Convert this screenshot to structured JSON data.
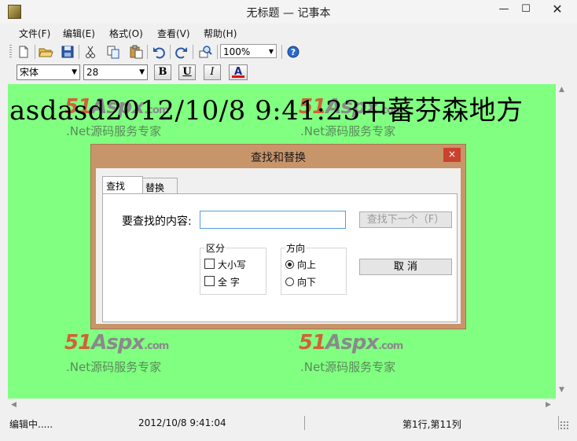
{
  "window": {
    "title": "无标题 — 记事本",
    "min": "—",
    "max": "☐",
    "close": "✕"
  },
  "menu": [
    "文件(F)",
    "编辑(E)",
    "格式(O)",
    "查看(V)",
    "帮助(H)"
  ],
  "toolbar": {
    "icons": [
      "new-file-icon",
      "open-folder-icon",
      "save-icon",
      "cut-icon",
      "copy-icon",
      "paste-icon",
      "undo-icon",
      "redo-icon",
      "find-icon",
      "help-icon"
    ],
    "zoom": "100%"
  },
  "format": {
    "font": "宋体",
    "size": "28",
    "bold": "B",
    "underline": "U",
    "italic": "I",
    "color": "A"
  },
  "editor": {
    "text": "asdasd2012/10/8 9:41:23中蕃芬森地方",
    "background": "#80ff80"
  },
  "watermark": {
    "logo_num": "51",
    "logo_word": "Aspx",
    "logo_tld": ".com",
    "subtitle": ".Net源码服务专家"
  },
  "statusbar": {
    "state": "编辑中.....",
    "datetime": "2012/10/8 9:41:04",
    "position": "第1行,第11列"
  },
  "dialog": {
    "title": "查找和替换",
    "close": "×",
    "tabs": [
      "查找",
      "替换"
    ],
    "find_label": "要查找的内容:",
    "find_value": "",
    "find_next": "查找下一个（F）",
    "cancel": "取 消",
    "group_case": {
      "label": "区分",
      "options": [
        "大小写",
        "全 字"
      ]
    },
    "group_dir": {
      "label": "方向",
      "options": [
        "向上",
        "向下"
      ],
      "selected": 0
    }
  }
}
